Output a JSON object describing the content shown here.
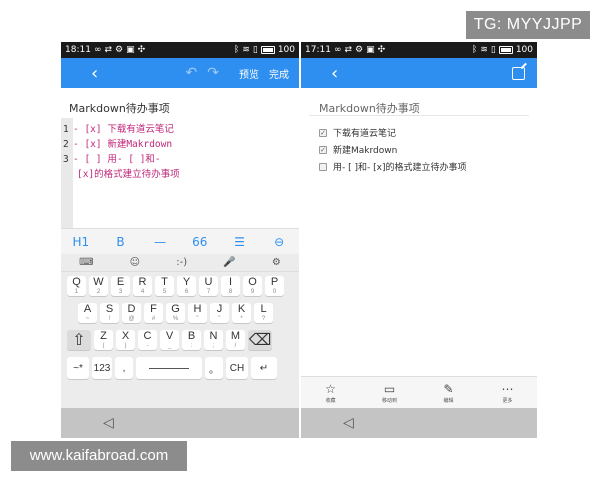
{
  "watermarks": {
    "tg": "TG: MYYJJPP",
    "site": "www.kaifabroad.com"
  },
  "left_phone": {
    "status": {
      "time": "18:11",
      "battery": "100"
    },
    "appbar": {
      "preview": "预览",
      "done": "完成"
    },
    "doc_title": "Markdown待办事项",
    "code_lines": [
      {
        "n": "1",
        "text": "- [x] 下载有道云笔记"
      },
      {
        "n": "2",
        "text": "- [x] 新建Makrdown"
      },
      {
        "n": "3",
        "text": "- [ ] 用- [ ]和-"
      },
      {
        "n": "",
        "text": "[x]的格式建立待办事项"
      }
    ],
    "md_toolbar": [
      "H1",
      "B",
      "—",
      "66",
      "☰",
      "⊖"
    ],
    "kb_top": [
      "⌨",
      "☺",
      ":-)",
      "🎤",
      "⚙"
    ],
    "kb_row1": [
      {
        "main": "Q",
        "sub": "1"
      },
      {
        "main": "W",
        "sub": "2"
      },
      {
        "main": "E",
        "sub": "3"
      },
      {
        "main": "R",
        "sub": "4"
      },
      {
        "main": "T",
        "sub": "5"
      },
      {
        "main": "Y",
        "sub": "6"
      },
      {
        "main": "U",
        "sub": "7"
      },
      {
        "main": "I",
        "sub": "8"
      },
      {
        "main": "O",
        "sub": "9"
      },
      {
        "main": "P",
        "sub": "0"
      }
    ],
    "kb_row2": [
      {
        "main": "A",
        "sub": "~"
      },
      {
        "main": "S",
        "sub": "!"
      },
      {
        "main": "D",
        "sub": "@"
      },
      {
        "main": "F",
        "sub": "#"
      },
      {
        "main": "G",
        "sub": "%"
      },
      {
        "main": "H",
        "sub": "\""
      },
      {
        "main": "J",
        "sub": "\""
      },
      {
        "main": "K",
        "sub": "*"
      },
      {
        "main": "L",
        "sub": "?"
      }
    ],
    "kb_row3": [
      {
        "main": "Z",
        "sub": "("
      },
      {
        "main": "X",
        "sub": ")"
      },
      {
        "main": "C",
        "sub": "-"
      },
      {
        "main": "V",
        "sub": "_"
      },
      {
        "main": "B",
        "sub": ":"
      },
      {
        "main": "N",
        "sub": ";"
      },
      {
        "main": "M",
        "sub": "/"
      }
    ],
    "kb_shift": "⇧",
    "kb_delete": "⌫",
    "kb_bottom": {
      "sym": "~*",
      "num": "123",
      "comma": ",",
      "period": "。",
      "lang": "CH",
      "enter": "↵"
    }
  },
  "right_phone": {
    "status": {
      "time": "17:11",
      "battery": "100"
    },
    "doc_title": "Markdown待办事项",
    "tasks": [
      {
        "checked": true,
        "check": "✓",
        "label": "下载有道云笔记"
      },
      {
        "checked": true,
        "check": "✓",
        "label": "新建Makrdown"
      },
      {
        "checked": false,
        "check": "",
        "label": "用- [ ]和- [x]的格式建立待办事项"
      }
    ],
    "bottom_bar": [
      {
        "icon": "☆",
        "label": "收藏",
        "name": "star-icon"
      },
      {
        "icon": "▭",
        "label": "移动到",
        "name": "folder-icon"
      },
      {
        "icon": "✎",
        "label": "编辑",
        "name": "edit-icon"
      },
      {
        "icon": "⋯",
        "label": "更多",
        "name": "more-icon"
      }
    ]
  }
}
